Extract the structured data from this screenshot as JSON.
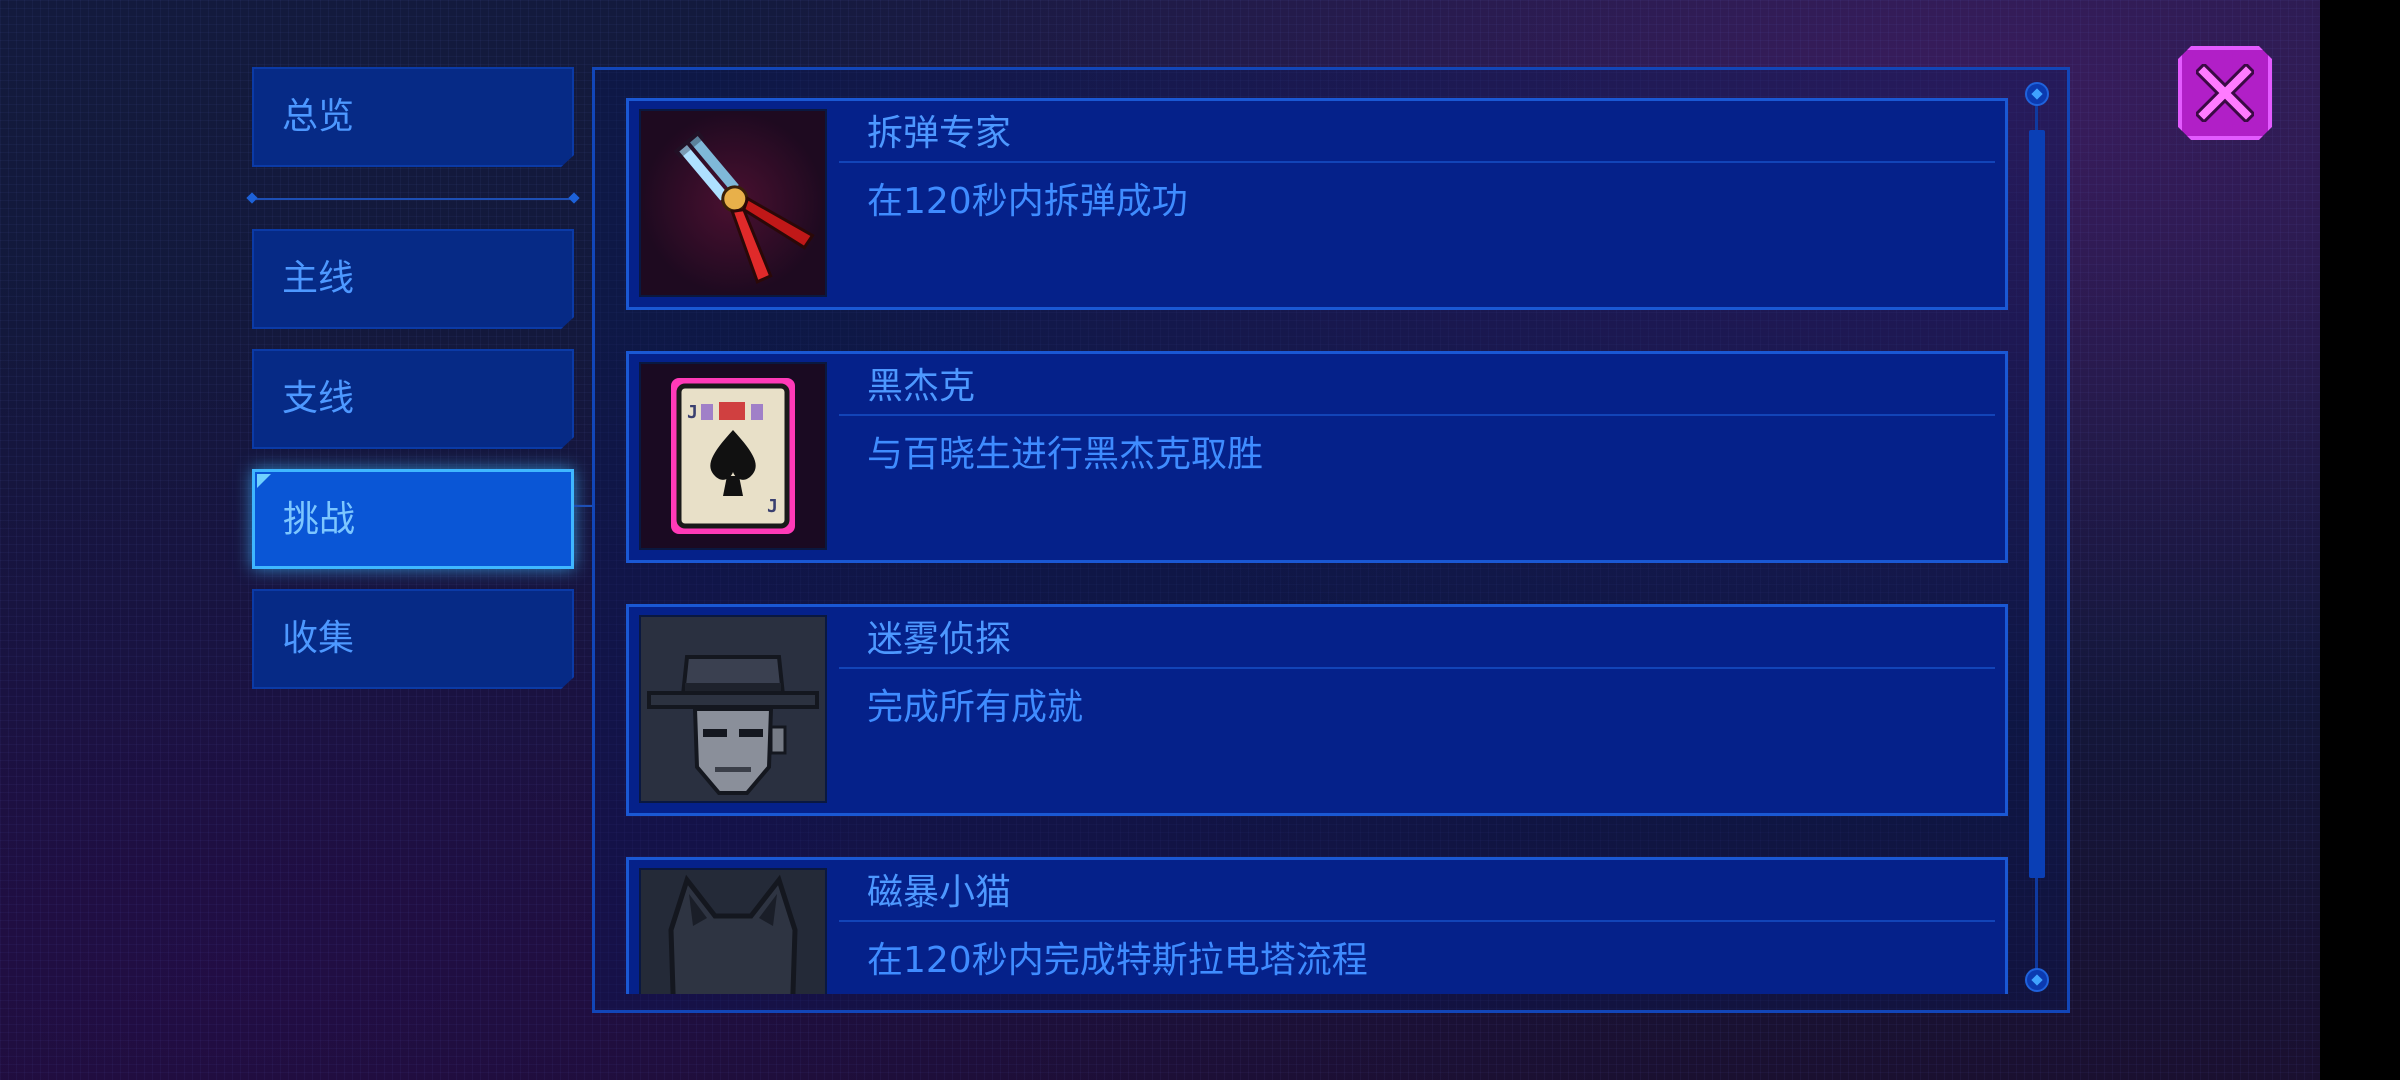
{
  "sidebar": {
    "tabs": [
      {
        "label": "总览"
      },
      {
        "label": "主线"
      },
      {
        "label": "支线"
      },
      {
        "label": "挑战",
        "active": true
      },
      {
        "label": "收集"
      }
    ]
  },
  "achievements": [
    {
      "title": "拆弹专家",
      "description": "在120秒内拆弹成功",
      "icon": "pliers-icon",
      "unlocked": true
    },
    {
      "title": "黑杰克",
      "description": "与百晓生进行黑杰克取胜",
      "icon": "spade-card-icon",
      "unlocked": true
    },
    {
      "title": "迷雾侦探",
      "description": "完成所有成就",
      "icon": "detective-icon",
      "unlocked": false
    },
    {
      "title": "磁暴小猫",
      "description": "在120秒内完成特斯拉电塔流程",
      "icon": "cat-icon",
      "unlocked": false
    }
  ],
  "colors": {
    "text": "#4d98ff",
    "item_bg": "#05218a",
    "active_tab": "#0a56d6",
    "close": "#b11fc7"
  }
}
